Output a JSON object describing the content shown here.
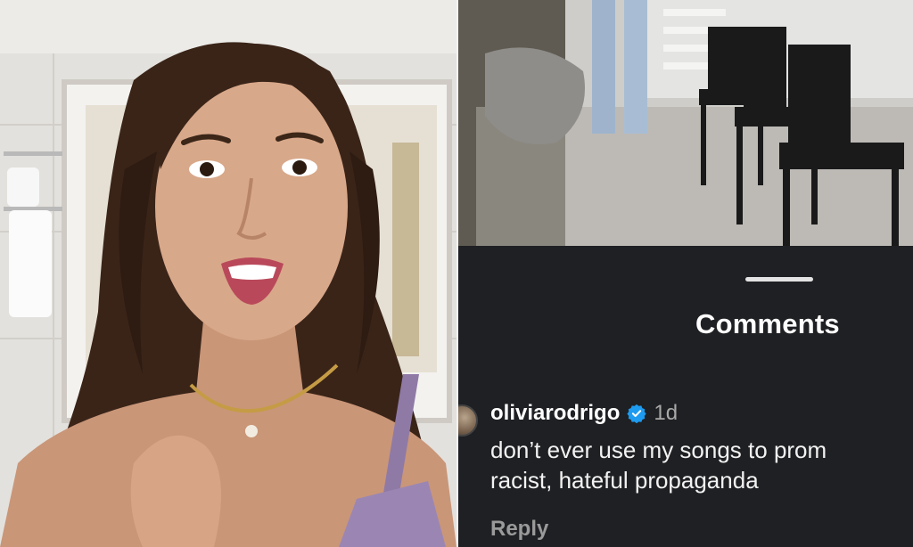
{
  "sheet": {
    "title": "Comments"
  },
  "comment": {
    "username": "oliviarodrigo",
    "verified": true,
    "time": "1d",
    "text": "don’t ever use my songs to prom\nracist, hateful propaganda",
    "reply_label": "Reply"
  },
  "colors": {
    "sheet_bg": "#1f2023",
    "verified_badge": "#1d9bf0",
    "secondary_text": "#a8a8a8"
  },
  "icons": {
    "verified": "verified-badge-icon"
  }
}
